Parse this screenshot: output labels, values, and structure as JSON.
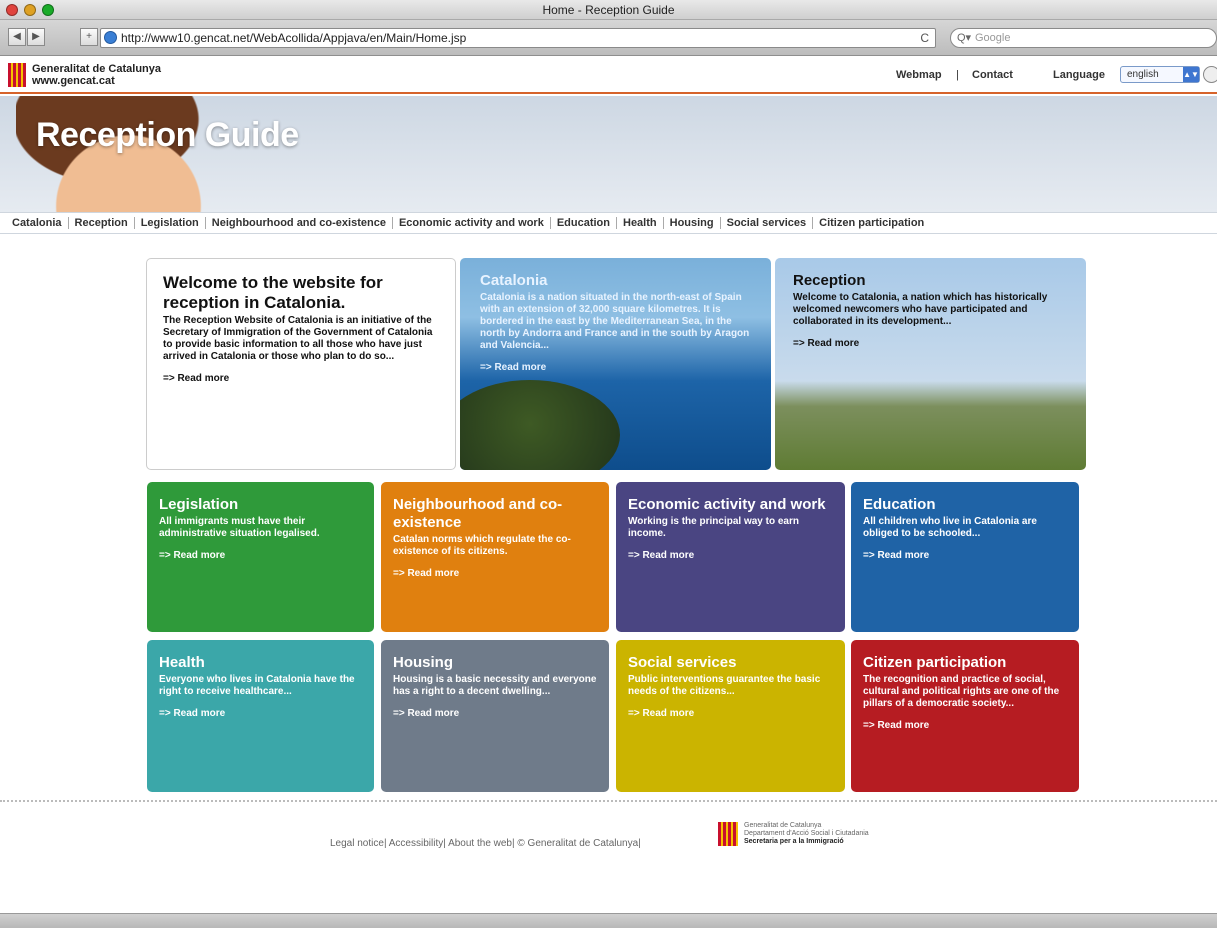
{
  "window": {
    "title": "Home - Reception Guide"
  },
  "browser": {
    "url": "http://www10.gencat.net/WebAcollida/Appjava/en/Main/Home.jsp",
    "search_placeholder": "Google",
    "reload": "C"
  },
  "header": {
    "org_line1": "Generalitat de Catalunya",
    "org_line2": "www.gencat.cat",
    "webmap": "Webmap",
    "separator": "|",
    "contact": "Contact",
    "language_label": "Language",
    "language_value": "english"
  },
  "banner": {
    "title": "Reception Guide"
  },
  "menu": [
    "Catalonia",
    "Reception",
    "Legislation",
    "Neighbourhood and co-existence",
    "Economic activity and work",
    "Education",
    "Health",
    "Housing",
    "Social services",
    "Citizen participation"
  ],
  "intro": {
    "welcome": {
      "title": "Welcome to the website for reception in Catalonia.",
      "text": "The Reception Website of Catalonia is an initiative of the Secretary of Immigration of the Government of Catalonia to provide basic information to all those who have just arrived in Catalonia or those who plan to do so...",
      "more": "=> Read more"
    },
    "catalonia": {
      "title": "Catalonia",
      "text": "Catalonia is a nation situated in the north-east of Spain with an extension of 32,000 square kilometres. It is bordered in the east by the Mediterranean Sea, in the north by Andorra and France and in the south by Aragon and Valencia...",
      "more": "=> Read more"
    },
    "reception": {
      "title": "Reception",
      "text": "Welcome to Catalonia, a nation which has historically welcomed newcomers who have participated and collaborated in its development...",
      "more": "=> Read more"
    }
  },
  "tiles": [
    {
      "title": "Legislation",
      "text": "All immigrants must have their administrative situation legalised.",
      "more": "=> Read more",
      "color": "#2f9a3a"
    },
    {
      "title": "Neighbourhood and co-existence",
      "text": "Catalan norms which regulate the co-existence of its citizens.",
      "more": "=> Read more",
      "color": "#e0800f"
    },
    {
      "title": "Economic activity and work",
      "text": "Working is the principal way to earn income.",
      "more": "=> Read more",
      "color": "#4a4582"
    },
    {
      "title": "Education",
      "text": "All children who live in Catalonia are obliged to be schooled...",
      "more": "=> Read more",
      "color": "#1f63a6"
    },
    {
      "title": "Health",
      "text": "Everyone who lives in Catalonia have the right to receive healthcare...",
      "more": "=> Read more",
      "color": "#3ba7a9"
    },
    {
      "title": "Housing",
      "text": "Housing is a basic necessity and everyone has a right to a decent dwelling...",
      "more": "=> Read more",
      "color": "#6f7b8a"
    },
    {
      "title": "Social services",
      "text": "Public interventions guarantee the basic needs of the citizens...",
      "more": "=> Read more",
      "color": "#cbb400"
    },
    {
      "title": "Citizen participation",
      "text": "The recognition and practice of social, cultural and political rights are one of the pillars of a democratic society...",
      "more": "=> Read more",
      "color": "#b61c22"
    }
  ],
  "footer": {
    "legal": "Legal notice",
    "accessibility": "Accessibility",
    "about": "About the web",
    "copyright": "© Generalitat de Catalunya",
    "org1": "Generalitat de Catalunya",
    "org2": "Departament d'Acció Social i Ciutadania",
    "org3": "Secretaria per a la Immigració"
  }
}
